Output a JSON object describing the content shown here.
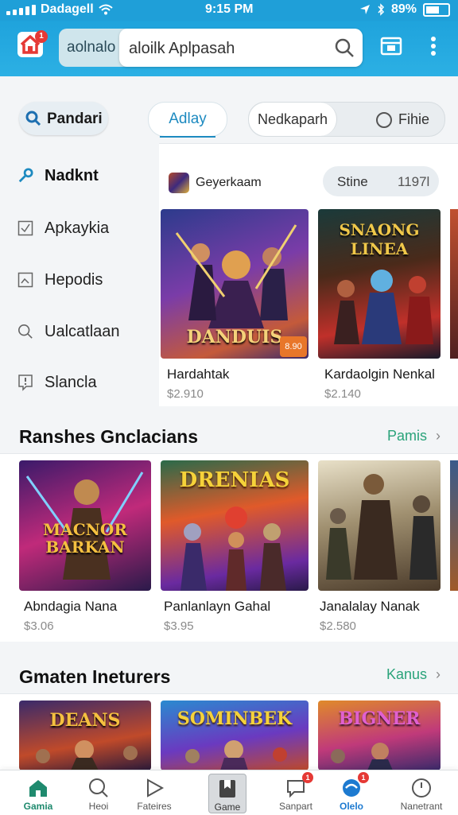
{
  "status_bar": {
    "carrier": "Dadagell",
    "time": "9:15 PM",
    "battery": "89%"
  },
  "app_bar": {
    "home_badge": "1",
    "search_chip": "aolnalo",
    "search_value": "aloilk Aplpasah",
    "icons": [
      "home-icon",
      "search-icon",
      "calendar-icon",
      "more-icon"
    ]
  },
  "filters": {
    "pandari": "Pandari",
    "adlay": "Adlay",
    "nedkapath": "Nedkaparh",
    "filter_label": "Fihie"
  },
  "sidebar": {
    "items": [
      {
        "label": "Nadknt",
        "icon": "wrench-icon",
        "active": true
      },
      {
        "label": "Apkaykia",
        "icon": "checkbox-icon",
        "active": false
      },
      {
        "label": "Hepodis",
        "icon": "image-icon",
        "active": false
      },
      {
        "label": "Ualcatlaan",
        "icon": "search-icon",
        "active": false
      },
      {
        "label": "Slancla",
        "icon": "info-icon",
        "active": false
      }
    ]
  },
  "featured": {
    "header_title": "Geyerkaam",
    "pill_label": "Stine",
    "pill_value": "1197l",
    "cards": [
      {
        "art_text": "DANDUIS",
        "title": "Hardahtak",
        "price": "$2.910",
        "badge": "8.90"
      },
      {
        "art_text": "SNAONG LINEA",
        "title": "Kardaolgin Nenkal",
        "price": "$2.140"
      }
    ]
  },
  "section1": {
    "title": "Ranshes Gnclacians",
    "see_all": "Pamis",
    "cards": [
      {
        "art_text": "MACNOR BARKAN",
        "title": "Abndagia Nana",
        "price": "$3.06"
      },
      {
        "art_text": "DRENIAS",
        "title": "Panlanlayn Gahal",
        "price": "$3.95"
      },
      {
        "art_text": "",
        "title": "Janalalay Nanak",
        "price": "$2.580"
      }
    ]
  },
  "section2": {
    "title": "Gmaten Ineturers",
    "see_all": "Kanus",
    "cards": [
      {
        "art_text": "DEANS"
      },
      {
        "art_text": "SOMINBEK"
      },
      {
        "art_text": "BIGNER"
      }
    ]
  },
  "bottom_nav": {
    "items": [
      {
        "label": "Gamia",
        "icon": "home-icon",
        "active": true
      },
      {
        "label": "Heoi",
        "icon": "search-icon"
      },
      {
        "label": "Fateires",
        "icon": "play-icon"
      },
      {
        "label": "Game",
        "icon": "bookmark-icon",
        "selected": true
      },
      {
        "label": "Sanpart",
        "icon": "chat-icon",
        "badge": "1"
      },
      {
        "label": "Olelo",
        "icon": "globe-icon",
        "badge": "1"
      },
      {
        "label": "Nanetrant",
        "icon": "clock-icon"
      }
    ]
  },
  "colors": {
    "header": "#1fa3dc",
    "accent_green": "#2aa37a",
    "tab_blue": "#1d8ac0",
    "badge_red": "#e53935"
  }
}
